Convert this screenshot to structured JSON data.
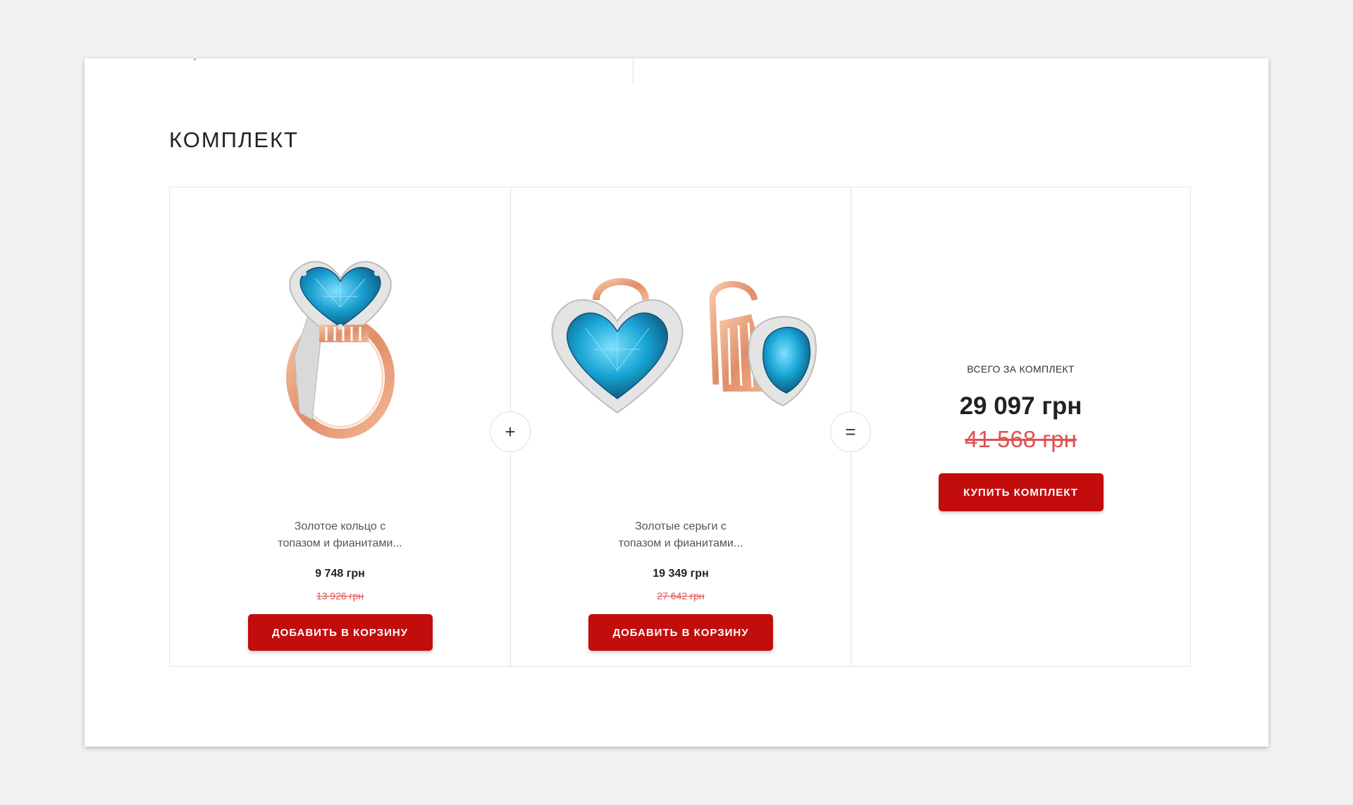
{
  "section": {
    "title": "КОМПЛЕКТ"
  },
  "operators": {
    "plus": "+",
    "equals": "="
  },
  "products": [
    {
      "name_line1": "Золотое кольцо с",
      "name_line2": "топазом и фианитами...",
      "price": "9 748 грн",
      "old_price": "13 926 грн",
      "button_label": "ДОБАВИТЬ В КОРЗИНУ",
      "image_icon": "ring-image"
    },
    {
      "name_line1": "Золотые серьги с",
      "name_line2": "топазом и фианитами...",
      "price": "19 349 грн",
      "old_price": "27 642 грн",
      "button_label": "ДОБАВИТЬ В КОРЗИНУ",
      "image_icon": "earrings-image"
    }
  ],
  "total": {
    "label": "ВСЕГО ЗА КОМПЛЕКТ",
    "price": "29 097 грн",
    "old_price": "41 568 грн",
    "button_label": "КУПИТЬ КОМПЛЕКТ"
  },
  "colors": {
    "accent": "#c30c0c",
    "old_price": "#e05050",
    "gem": "#1a9fd0",
    "gold": "#e8a07a"
  }
}
